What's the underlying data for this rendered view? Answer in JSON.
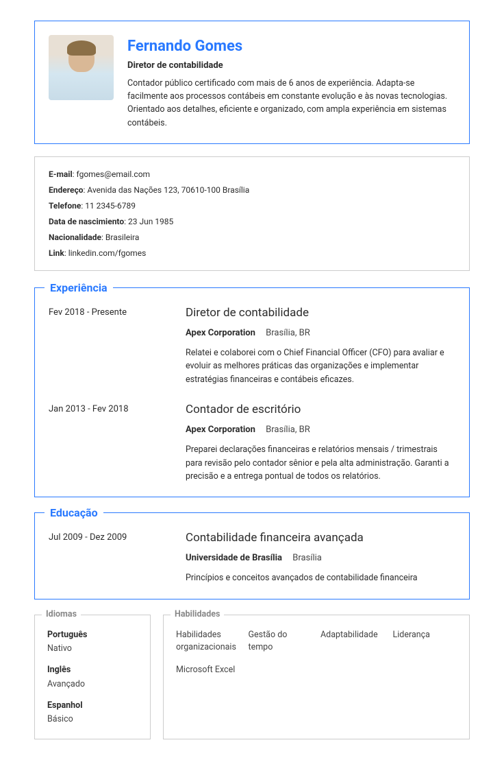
{
  "header": {
    "name": "Fernando Gomes",
    "title": "Diretor de contabilidade",
    "summary": "Contador público certificado com mais de 6 anos de experiência. Adapta-se facilmente aos processos contábeis em constante evolução e às novas tecnologias. Orientado aos detalhes, eficiente e organizado, com ampla experiência em sistemas contábeis."
  },
  "contact": {
    "email_label": "E-mail",
    "email": "fgomes@email.com",
    "address_label": "Endereço",
    "address": "Avenida das Nações 123, 70610-100 Brasília",
    "phone_label": "Telefone",
    "phone": "11 2345-6789",
    "dob_label": "Data de nascimiento",
    "dob": "23 Jun 1985",
    "nationality_label": "Nacionalidade",
    "nationality": "Brasileira",
    "link_label": "Link",
    "link": "linkedin.com/fgomes"
  },
  "sections": {
    "experience_title": "Experiência",
    "education_title": "Educação",
    "languages_title": "Idiomas",
    "skills_title": "Habilidades"
  },
  "experience": [
    {
      "date": "Fev 2018 - Presente",
      "title": "Diretor de contabilidade",
      "org": "Apex Corporation",
      "loc": "Brasília, BR",
      "desc": "Relatei e colaborei com o Chief Financial Officer (CFO) para avaliar e evoluir as melhores práticas das organizações e implementar estratégias financeiras e contábeis eficazes."
    },
    {
      "date": "Jan 2013 - Fev 2018",
      "title": "Contador de escritório",
      "org": "Apex Corporation",
      "loc": "Brasília, BR",
      "desc": "Preparei declarações financeiras e relatórios mensais / trimestrais para revisão pelo contador sênior e pela alta administração. Garanti a precisão e a entrega pontual de todos os relatórios."
    }
  ],
  "education": [
    {
      "date": "Jul 2009 - Dez 2009",
      "title": "Contabilidade financeira avançada",
      "org": "Universidade de Brasília",
      "loc": "Brasília",
      "desc": "Princípios e conceitos avançados de contabilidade financeira"
    }
  ],
  "languages": [
    {
      "name": "Português",
      "level": "Nativo"
    },
    {
      "name": "Inglês",
      "level": "Avançado"
    },
    {
      "name": "Espanhol",
      "level": "Básico"
    }
  ],
  "skills": [
    "Habilidades organizacionais",
    "Gestão do tempo",
    "Adaptabilidade",
    "Liderança",
    "Microsoft Excel"
  ]
}
